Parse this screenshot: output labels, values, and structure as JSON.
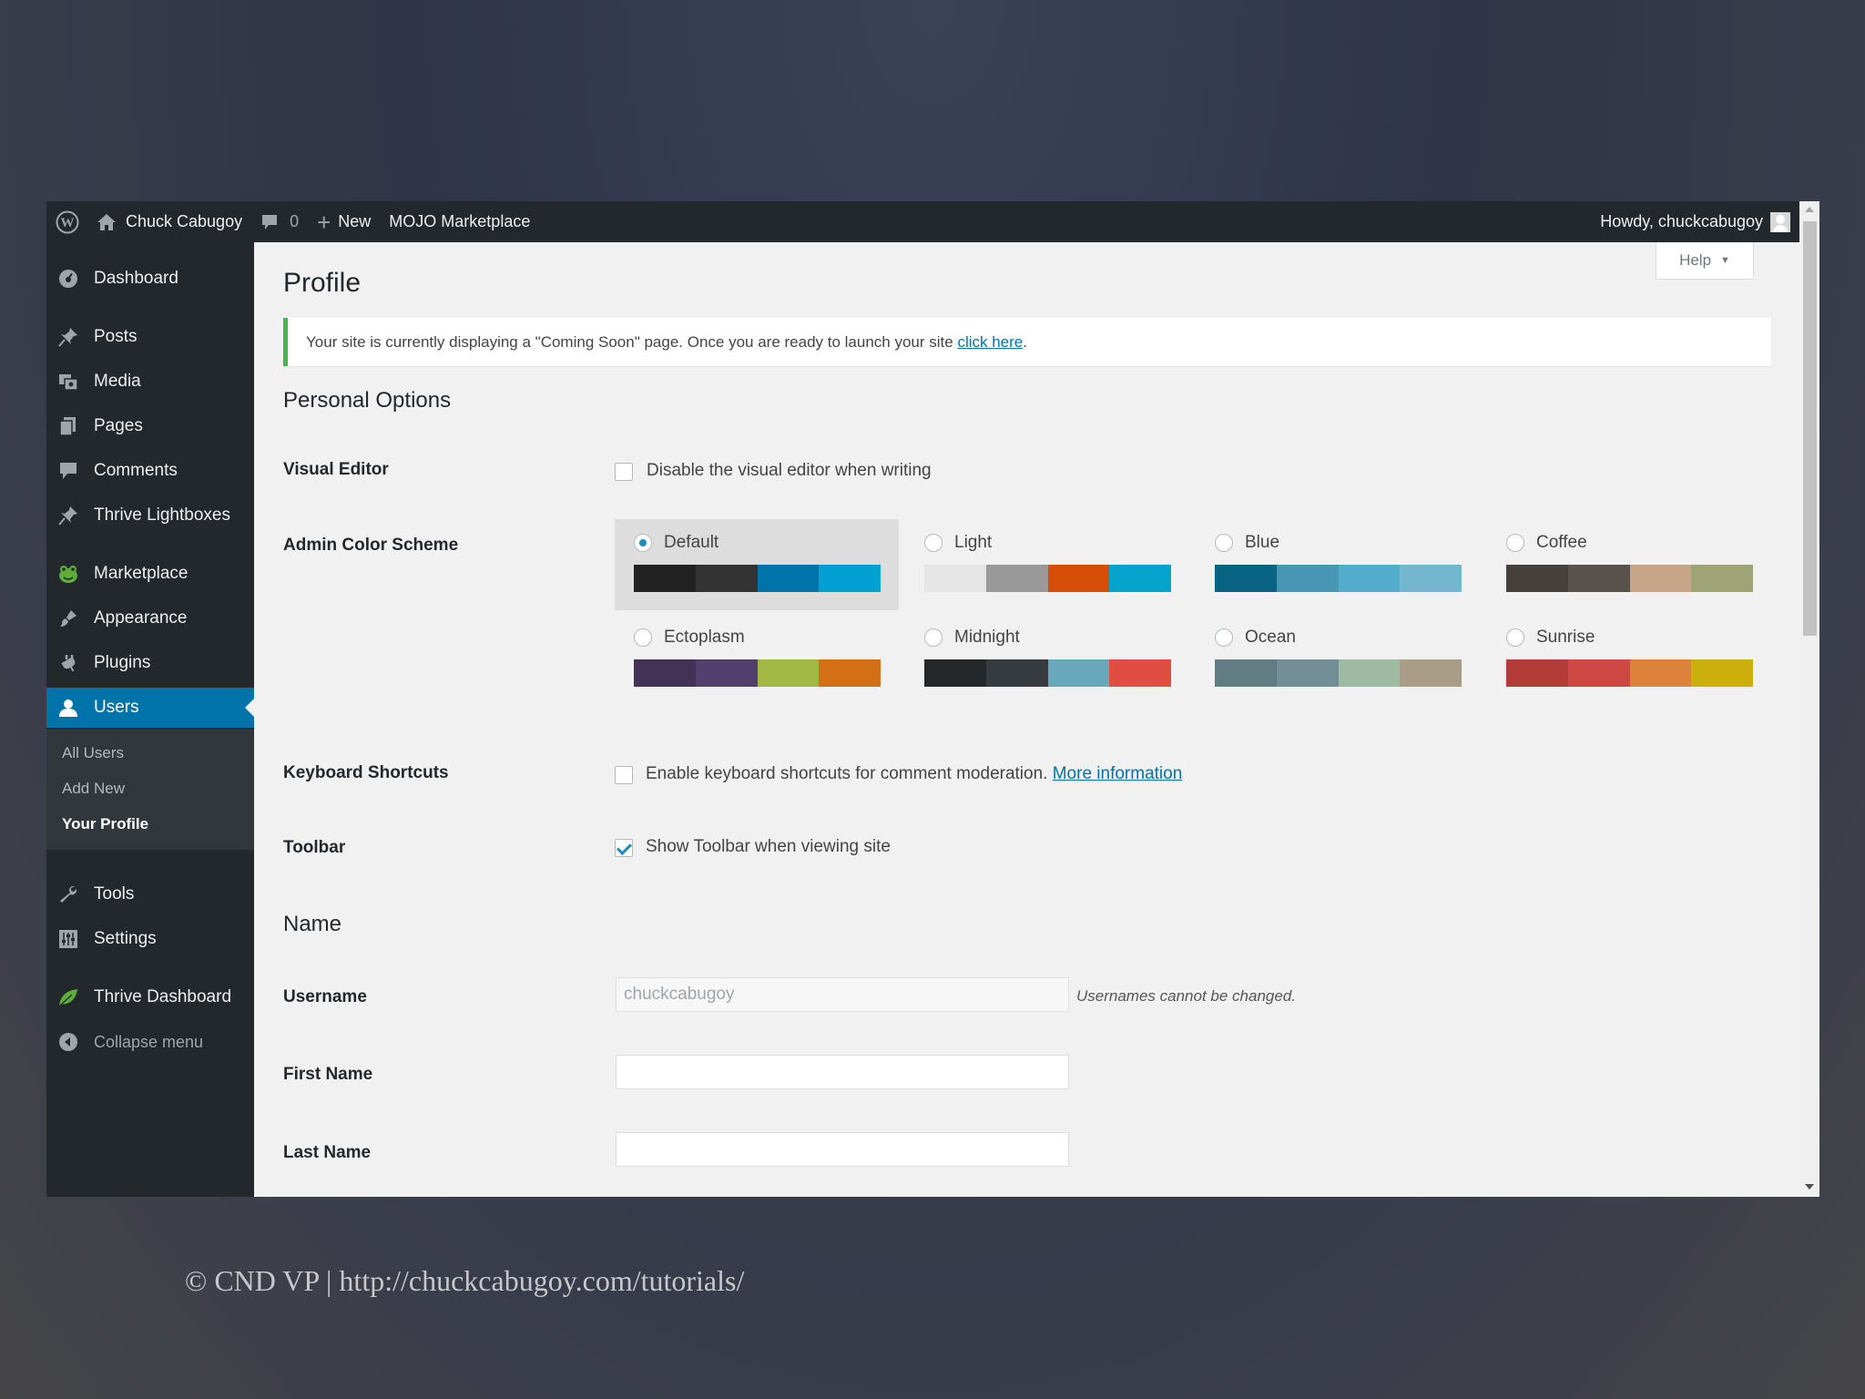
{
  "adminbar": {
    "site_name": "Chuck Cabugoy",
    "comments_count": "0",
    "new_label": "New",
    "marketplace_label": "MOJO Marketplace",
    "howdy": "Howdy, chuckcabugoy"
  },
  "sidebar": {
    "items": [
      {
        "label": "Dashboard",
        "icon": "dashboard-icon"
      },
      {
        "label": "Posts",
        "icon": "pin-icon"
      },
      {
        "label": "Media",
        "icon": "media-icon"
      },
      {
        "label": "Pages",
        "icon": "pages-icon"
      },
      {
        "label": "Comments",
        "icon": "comment-icon"
      },
      {
        "label": "Thrive Lightboxes",
        "icon": "pin-icon"
      },
      {
        "label": "Marketplace",
        "icon": "frog-icon"
      },
      {
        "label": "Appearance",
        "icon": "brush-icon"
      },
      {
        "label": "Plugins",
        "icon": "plug-icon"
      },
      {
        "label": "Users",
        "icon": "user-icon"
      },
      {
        "label": "Tools",
        "icon": "wrench-icon"
      },
      {
        "label": "Settings",
        "icon": "settings-icon"
      },
      {
        "label": "Thrive Dashboard",
        "icon": "leaf-icon"
      },
      {
        "label": "Collapse menu",
        "icon": "collapse-icon"
      }
    ],
    "users_submenu": [
      "All Users",
      "Add New",
      "Your Profile"
    ]
  },
  "main": {
    "help_label": "Help",
    "page_title": "Profile",
    "notice_text": "Your site is currently displaying a \"Coming Soon\" page. Once you are ready to launch your site ",
    "notice_link": "click here",
    "notice_end": ".",
    "personal_options_heading": "Personal Options",
    "visual_editor_label": "Visual Editor",
    "visual_editor_text": "Disable the visual editor when writing",
    "visual_editor_checked": false,
    "color_scheme_label": "Admin Color Scheme",
    "color_schemes": [
      {
        "name": "Default",
        "selected": true,
        "colors": [
          "#222222",
          "#333333",
          "#0073aa",
          "#00a0d2"
        ]
      },
      {
        "name": "Light",
        "selected": false,
        "colors": [
          "#e5e5e5",
          "#999999",
          "#d64e07",
          "#04a4cc"
        ]
      },
      {
        "name": "Blue",
        "selected": false,
        "colors": [
          "#096484",
          "#4796b3",
          "#52accc",
          "#74B6CE"
        ]
      },
      {
        "name": "Coffee",
        "selected": false,
        "colors": [
          "#46403c",
          "#59524c",
          "#c7a589",
          "#9ea476"
        ]
      },
      {
        "name": "Ectoplasm",
        "selected": false,
        "colors": [
          "#413256",
          "#523f6d",
          "#a3b745",
          "#d46f15"
        ]
      },
      {
        "name": "Midnight",
        "selected": false,
        "colors": [
          "#25282b",
          "#363b3f",
          "#69a8bb",
          "#e14d43"
        ]
      },
      {
        "name": "Ocean",
        "selected": false,
        "colors": [
          "#627c83",
          "#738e96",
          "#9ebaa0",
          "#aa9d88"
        ]
      },
      {
        "name": "Sunrise",
        "selected": false,
        "colors": [
          "#b43c38",
          "#cf4944",
          "#dd823b",
          "#ccaf0b"
        ]
      }
    ],
    "keyboard_label": "Keyboard Shortcuts",
    "keyboard_text": "Enable keyboard shortcuts for comment moderation.",
    "keyboard_link": "More information",
    "keyboard_checked": false,
    "toolbar_label": "Toolbar",
    "toolbar_text": "Show Toolbar when viewing site",
    "toolbar_checked": true,
    "name_heading": "Name",
    "username_label": "Username",
    "username_value": "chuckcabugoy",
    "username_desc": "Usernames cannot be changed.",
    "first_name_label": "First Name",
    "first_name_value": "",
    "last_name_label": "Last Name",
    "last_name_value": ""
  },
  "footer": {
    "text": "© CND VP | http://chuckcabugoy.com/tutorials/"
  }
}
